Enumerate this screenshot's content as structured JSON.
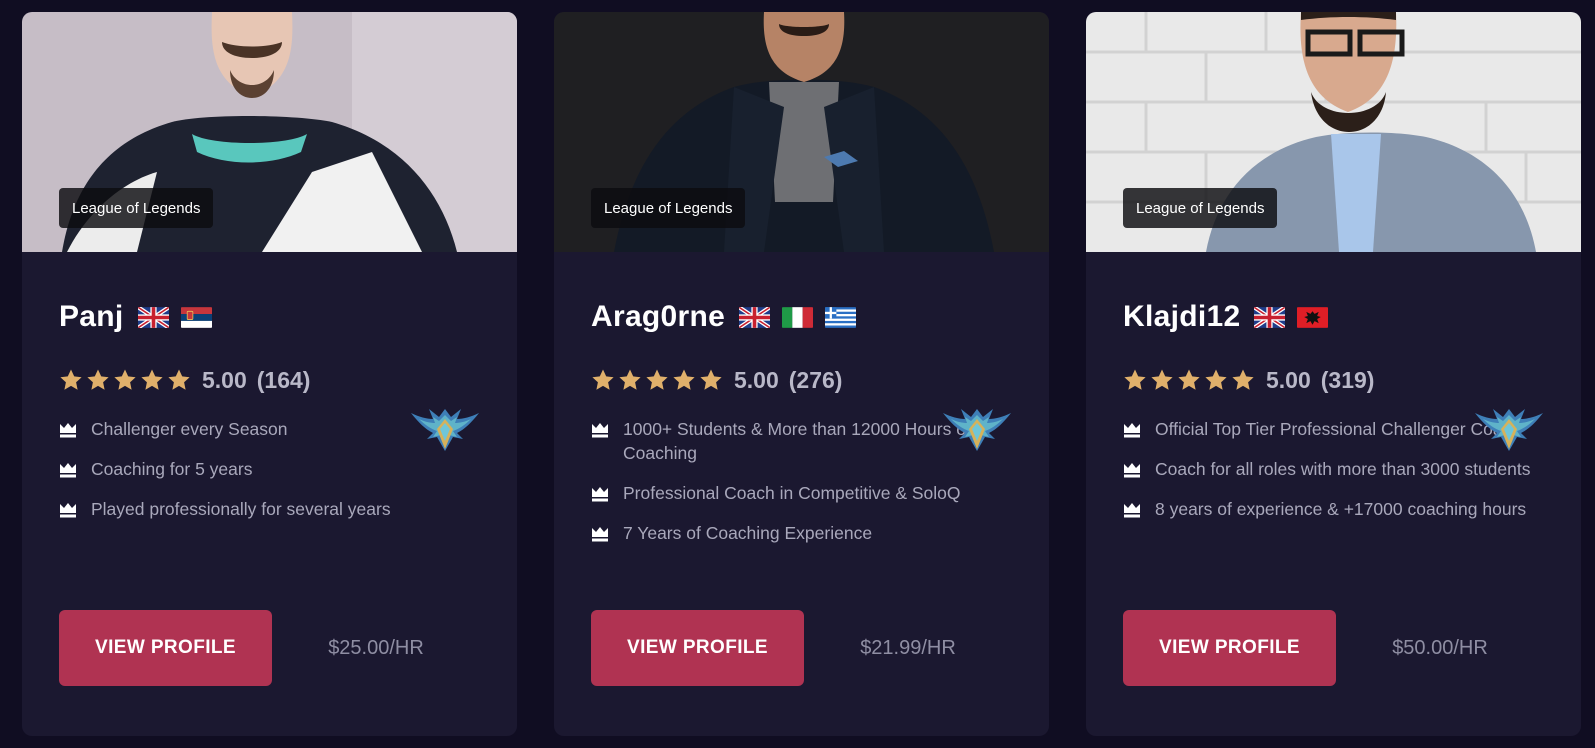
{
  "coaches": [
    {
      "game": "League of Legends",
      "name": "Panj",
      "flags": [
        "uk-flag",
        "serbia-flag"
      ],
      "rating": "5.00",
      "reviews": "(164)",
      "stars": 5,
      "rank_icon": "challenger-emblem-icon",
      "features": [
        "Challenger every Season",
        "Coaching for 5 years",
        "Played professionally for several years"
      ],
      "button_label": "VIEW PROFILE",
      "price": "$25.00/HR"
    },
    {
      "game": "League of Legends",
      "name": "Arag0rne",
      "flags": [
        "uk-flag",
        "italy-flag",
        "greece-flag"
      ],
      "rating": "5.00",
      "reviews": "(276)",
      "stars": 5,
      "rank_icon": "challenger-emblem-icon",
      "features": [
        "1000+ Students & More than 12000 Hours of Coaching",
        "Professional Coach in Competitive & SoloQ",
        "7 Years of Coaching Experience"
      ],
      "button_label": "VIEW PROFILE",
      "price": "$21.99/HR"
    },
    {
      "game": "League of Legends",
      "name": "Klajdi12",
      "flags": [
        "uk-flag",
        "albania-flag"
      ],
      "rating": "5.00",
      "reviews": "(319)",
      "stars": 5,
      "rank_icon": "challenger-emblem-icon",
      "features": [
        "Official Top Tier Professional Challenger Coach",
        "Coach for all roles with more than 3000 students",
        "8 years of experience & +17000 coaching hours"
      ],
      "button_label": "VIEW PROFILE",
      "price": "$50.00/HR"
    }
  ],
  "colors": {
    "page_background": "#100d22",
    "card_background": "#1b1830",
    "button": "#b03352",
    "star": "#e0b06b"
  }
}
